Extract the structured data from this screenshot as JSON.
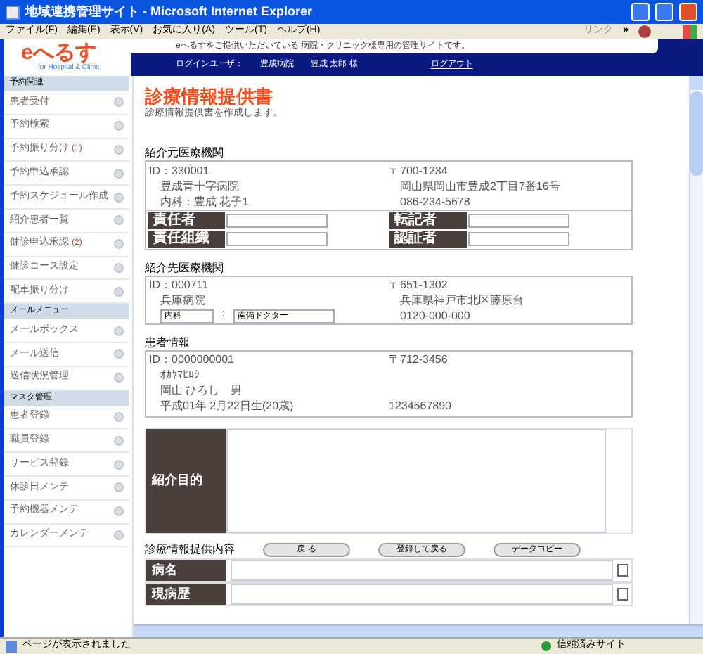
{
  "window": {
    "title": "地域連携管理サイト - Microsoft Internet Explorer"
  },
  "menu_bar": {
    "items": [
      "ファイル(F)",
      "編集(E)",
      "表示(V)",
      "お気に入り(A)",
      "ツール(T)",
      "ヘルプ(H)"
    ],
    "links_label": "リンク",
    "links_more": "»"
  },
  "header": {
    "logo": "eへるす",
    "logo_sub": "for Hospital & Clinic",
    "notice": "eへるすをご提供いただいている 病院・クリニック様専用の管理サイトです。",
    "user_label": "ログインユーザ：",
    "user_hospital": "豊成病院",
    "user_name": "豊成 太郎 様",
    "logout": "ログアウト"
  },
  "sidebar": {
    "sections": [
      {
        "title": "予約関連",
        "items": [
          {
            "label": "患者受付"
          },
          {
            "label": "予約検索"
          },
          {
            "label": "予約振り分け",
            "badge": "(1)"
          },
          {
            "label": "予約申込承認"
          },
          {
            "label": "予約スケジュール作成"
          },
          {
            "label": "紹介患者一覧"
          },
          {
            "label": "健診申込承認",
            "badge": "(2)"
          },
          {
            "label": "健診コース設定"
          },
          {
            "label": "配車振り分け"
          }
        ]
      },
      {
        "title": "メールメニュー",
        "items": [
          {
            "label": "メールボックス"
          },
          {
            "label": "メール送信"
          },
          {
            "label": "送信状況管理"
          }
        ]
      },
      {
        "title": "マスタ管理",
        "items": [
          {
            "label": "患者登録"
          },
          {
            "label": "職員登録"
          },
          {
            "label": "サービス登録"
          },
          {
            "label": "休診日メンテ"
          },
          {
            "label": "予約機器メンテ"
          },
          {
            "label": "カレンダーメンテ"
          }
        ]
      }
    ]
  },
  "page": {
    "title": "診療情報提供書",
    "subtitle": "診療情報提供書を作成します。"
  },
  "referrer": {
    "heading": "紹介元医療機関",
    "id": "ID：330001",
    "name": "豊成青十字病院",
    "dept": "内科：豊成 花子1",
    "postal": "〒700-1234",
    "address": "岡山県岡山市豊成2丁目7番16号",
    "phone": "086-234-5678",
    "fields": [
      {
        "label": "責任者"
      },
      {
        "label": "転記者"
      },
      {
        "label": "責任組織"
      },
      {
        "label": "認証者"
      }
    ]
  },
  "referral_to": {
    "heading": "紹介先医療機関",
    "id": "ID：000711",
    "name": "兵庫病院",
    "dept_value": "内科",
    "separator": ":",
    "doctor_value": "南備ドクター",
    "postal": "〒651-1302",
    "address": "兵庫県神戸市北区藤原台",
    "phone": "0120-000-000"
  },
  "patient": {
    "heading": "患者情報",
    "id": "ID：0000000001",
    "kana": "ｵｶﾔﾏﾋﾛｼ",
    "name": "岡山 ひろし　男",
    "birth": "平成01年 2月22日生(20歳)",
    "postal": "〒712-3456",
    "phone": "1234567890"
  },
  "purpose": {
    "label": "紹介目的"
  },
  "content": {
    "heading": "診療情報提供内容",
    "buttons": [
      "戻 る",
      "登録して戻る",
      "データコピー"
    ],
    "rows": [
      {
        "label": "病名"
      },
      {
        "label": "現病歴"
      }
    ]
  },
  "status_bar": {
    "text": "ページが表示されました",
    "zone": "信頼済みサイト"
  }
}
